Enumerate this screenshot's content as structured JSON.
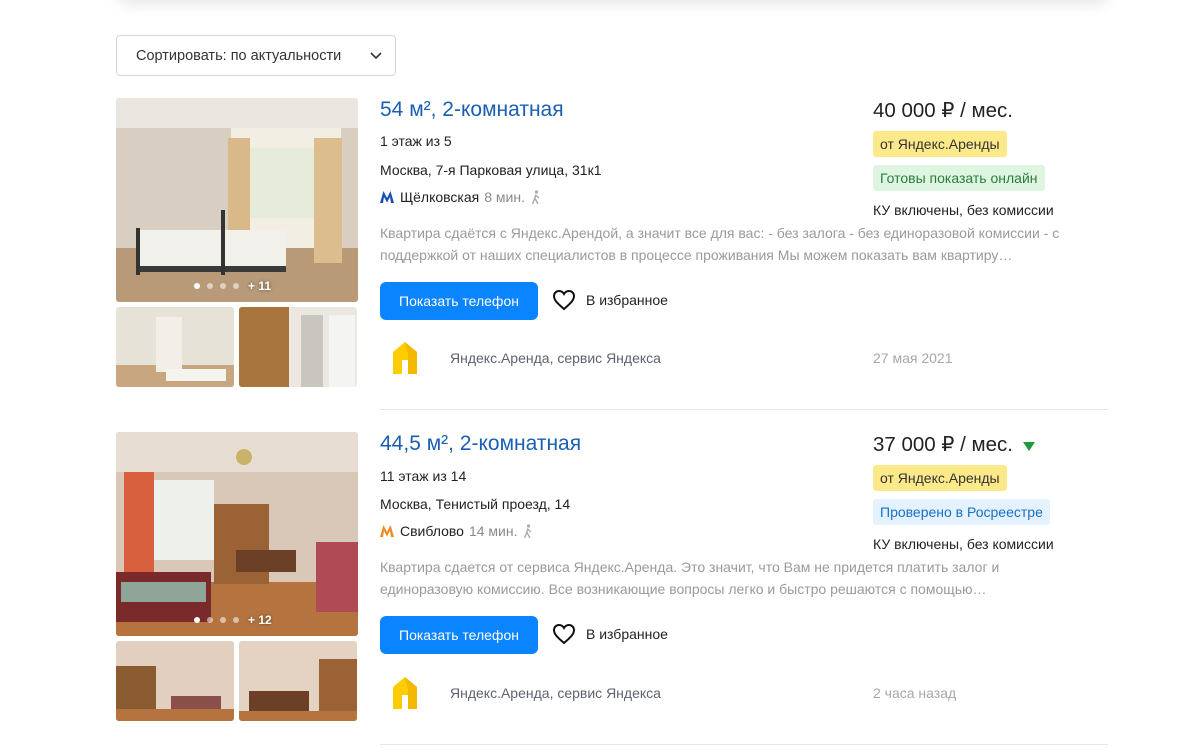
{
  "sort": {
    "label": "Сортировать: по актуальности"
  },
  "listings": [
    {
      "title": "54 м², 2-комнатная",
      "floor": "1 этаж из 5",
      "address": "Москва, 7-я Парковая улица, 31к1",
      "metro": {
        "name": "Щёлковская",
        "time": "8 мин.",
        "line_color": "#1a4fb4"
      },
      "description": "Квартира сдаётся с Яндекс.Арендой, а значит все для вас: - без залога - без единоразовой комиссии - с поддержкой от наших специалистов в процессе проживания Мы можем показать вам квартиру…",
      "photos_more": "+ 11",
      "phone_button": "Показать телефон",
      "favorite": "В избранное",
      "agency": "Яндекс.Аренда, сервис Яндекса",
      "date": "27 мая 2021",
      "price": "40 000 ₽ / мес.",
      "badge_primary": "от Яндекс.Аренды",
      "badge_secondary": "Готовы показать онлайн",
      "terms": "КУ включены, без комиссии"
    },
    {
      "title": "44,5 м², 2-комнатная",
      "floor": "11 этаж из 14",
      "address": "Москва, Тенистый проезд, 14",
      "metro": {
        "name": "Свиблово",
        "time": "14 мин.",
        "line_color": "#f08a24"
      },
      "description": "Квартира сдается от сервиса Яндекс.Аренда. Это значит, что Вам не придется платить залог и единоразовую комиссию. Все возникающие вопросы легко и быстро решаются с помощью…",
      "photos_more": "+ 12",
      "phone_button": "Показать телефон",
      "favorite": "В избранное",
      "agency": "Яндекс.Аренда, сервис Яндекса",
      "date": "2 часа назад",
      "price": "37 000 ₽ / мес.",
      "price_trend": "down",
      "badge_primary": "от Яндекс.Аренды",
      "badge_secondary": "Проверено в Росреестре",
      "terms": "КУ включены, без комиссии"
    }
  ],
  "colors": {
    "link": "#1a5fb4",
    "button": "#0a84ff",
    "badge_yellow": "#fce98a",
    "price_down": "#1f9a3a"
  }
}
